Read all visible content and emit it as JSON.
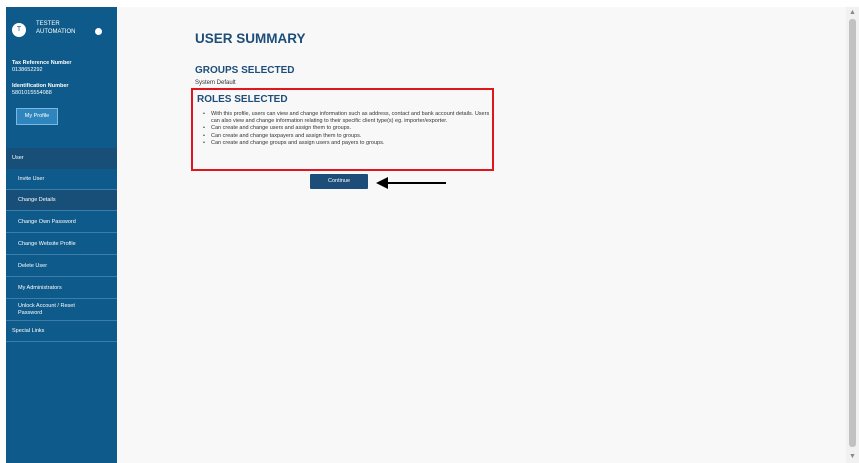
{
  "user": {
    "initial": "T",
    "name": "TESTER AUTOMATION",
    "tax_ref_label": "Tax Reference Number",
    "tax_ref_value": "0138652292",
    "id_label": "Identification Number",
    "id_value": "5801015554088",
    "profile_button": "My Profile"
  },
  "sidebar": {
    "section_label": "User",
    "items": [
      {
        "label": "Invite User"
      },
      {
        "label": "Change Details"
      },
      {
        "label": "Change Own Password"
      },
      {
        "label": "Change Website Profile"
      },
      {
        "label": "Delete User"
      },
      {
        "label": "My Administrators"
      },
      {
        "label": "Unlock Account / Reset Password"
      }
    ],
    "special_links": "Special Links"
  },
  "main": {
    "title": "USER SUMMARY",
    "groups_heading": "GROUPS SELECTED",
    "groups_value": "System Default",
    "roles_heading": "ROLES SELECTED",
    "roles": [
      "With this profile, users can view and change information such as address, contact and bank account details. Users can also view and change information relating to their specific client type(s) eg. importer/exporter.",
      "Can create and change users and assign them to groups.",
      "Can create and change taxpayers and assign them to groups.",
      "Can create and change groups and assign users and payers to groups."
    ],
    "continue_button": "Continue"
  }
}
